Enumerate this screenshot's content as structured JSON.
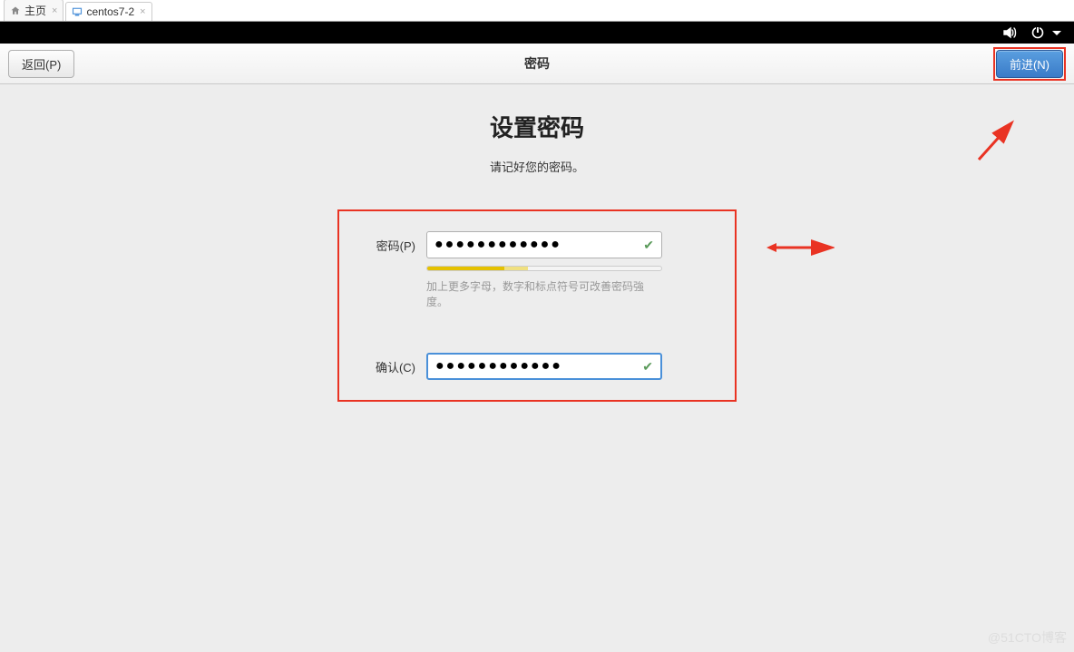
{
  "tabs": {
    "home": "主页",
    "vm": "centos7-2"
  },
  "header": {
    "back": "返回(P)",
    "title": "密码",
    "forward": "前进(N)"
  },
  "page": {
    "heading": "设置密码",
    "subtitle": "请记好您的密码。"
  },
  "form": {
    "password_label": "密码(P)",
    "password_value": "●●●●●●●●●●●●",
    "confirm_label": "确认(C)",
    "confirm_value": "●●●●●●●●●●●●",
    "hint": "加上更多字母，数字和标点符号可改善密码強度。"
  },
  "watermark": "@51CTO博客"
}
